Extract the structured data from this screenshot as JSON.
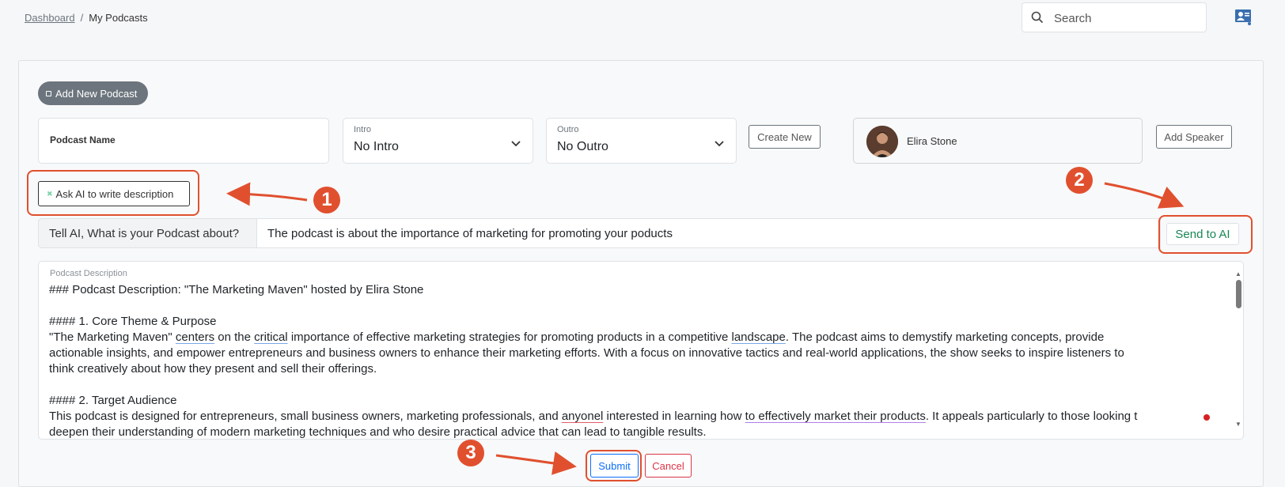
{
  "breadcrumb": {
    "home": "Dashboard",
    "separator": "/",
    "current": "My Podcasts"
  },
  "search": {
    "placeholder": "Search"
  },
  "form": {
    "add_podcast_label": "Add New Podcast",
    "podcast_name_label": "Podcast Name",
    "intro": {
      "label": "Intro",
      "value": "No Intro"
    },
    "outro": {
      "label": "Outro",
      "value": "No Outro"
    },
    "create_new_label": "Create New",
    "speaker": {
      "name": "Elira Stone"
    },
    "add_speaker_label": "Add Speaker",
    "ask_ai_label": "Ask AI to write description",
    "ask_prompt_label": "Tell AI, What is your Podcast about?",
    "ask_prompt_value": "The podcast is about the importance of marketing for promoting your poducts",
    "send_label": "Send to AI",
    "description_label": "Podcast Description",
    "submit_label": "Submit",
    "cancel_label": "Cancel"
  },
  "description": {
    "l1": "### Podcast Description: \"The Marketing Maven\" hosted by Elira Stone",
    "l2": "#### 1. Core Theme & Purpose",
    "l3a": "\"The Marketing Maven\" ",
    "l3b": "centers",
    "l3c": " on the ",
    "l3d": "critical",
    "l3e": " importance of effective marketing strategies for promoting products in a competitive ",
    "l3f": "landscape",
    "l3g": ". The podcast aims to demystify marketing concepts, provide",
    "l4": "actionable insights, and empower entrepreneurs and business owners to enhance their marketing efforts. With a focus on innovative tactics and real-world applications, the show seeks to inspire listeners to",
    "l5": "think creatively about how they present and sell their offerings.",
    "l6": "#### 2. Target Audience",
    "l7a": "This podcast is designed for entrepreneurs, small business owners, marketing professionals, and ",
    "l7b": "anyonel",
    "l7c": " interested in learning how ",
    "l7d": "to effectively market their products",
    "l7e": ". It appeals particularly to those looking t",
    "l8": "deepen their understanding of modern marketing techniques and who desire practical advice that can lead to tangible results."
  },
  "annotations": [
    "1",
    "2",
    "3"
  ],
  "colors": {
    "annotation": "#e0502f",
    "send": "#198754",
    "submit": "#0d6efd",
    "cancel": "#dc3545"
  }
}
